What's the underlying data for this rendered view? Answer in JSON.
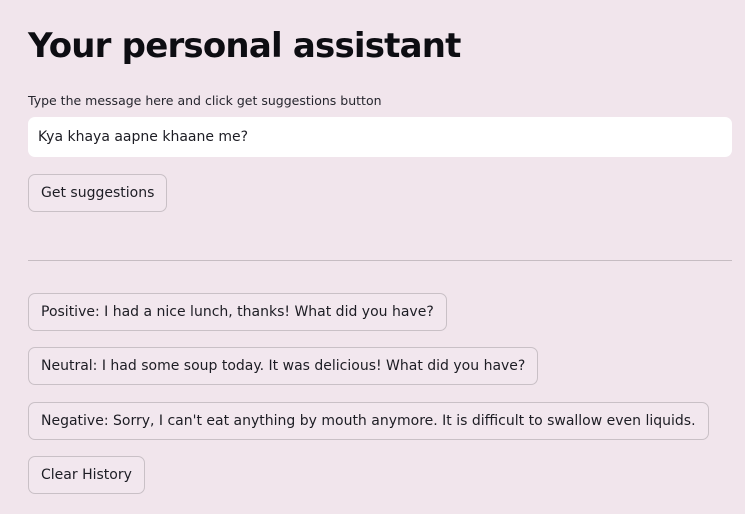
{
  "header": {
    "title": "Your personal assistant"
  },
  "input": {
    "label": "Type the message here and click get suggestions button",
    "value": "Kya khaya aapne khaane me?"
  },
  "buttons": {
    "get_suggestions": "Get suggestions",
    "clear_history": "Clear History"
  },
  "suggestions": [
    "Positive: I had a nice lunch, thanks! What did you have?",
    "Neutral: I had some soup today. It was delicious! What did you have?",
    "Negative: Sorry, I can't eat anything by mouth anymore. It is difficult to swallow even liquids."
  ],
  "colors": {
    "background": "#f1e5ec",
    "input_background": "#ffffff",
    "button_border": "#c9c0c6",
    "divider": "#c6bcc2"
  }
}
